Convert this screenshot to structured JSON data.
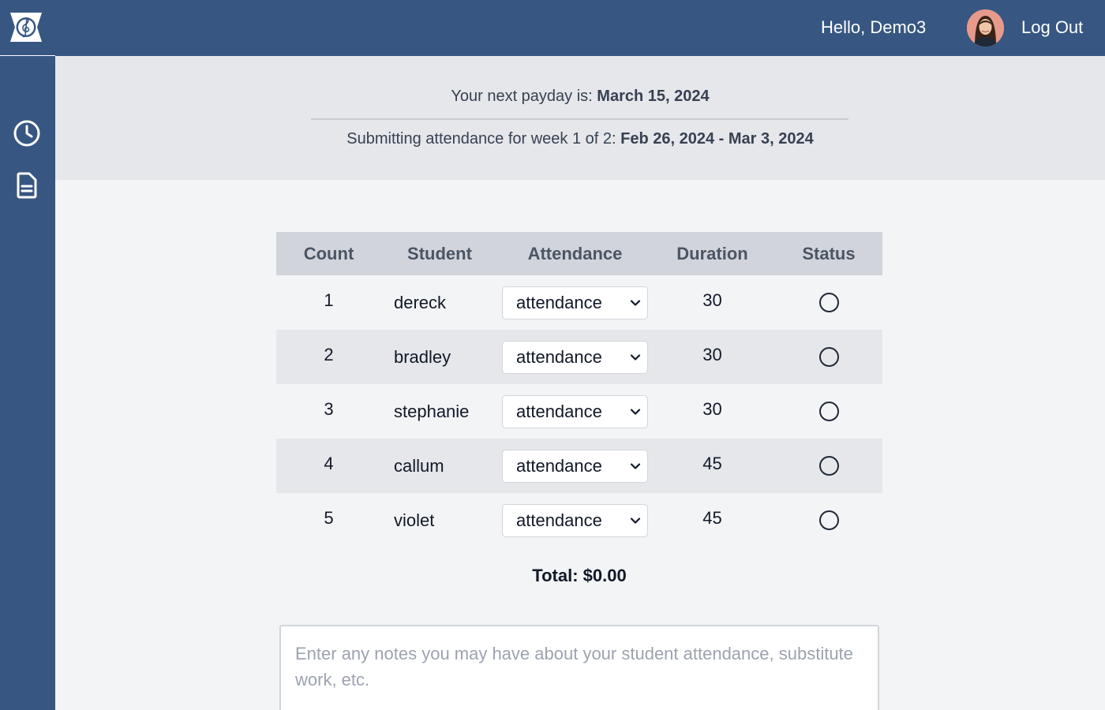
{
  "header": {
    "greeting": "Hello, Demo3",
    "logout_label": "Log Out"
  },
  "sidebar": {
    "items": [
      {
        "icon": "clock-icon"
      },
      {
        "icon": "document-icon"
      }
    ]
  },
  "info": {
    "payday_label": "Your next payday is:",
    "payday_date": "March 15, 2024",
    "week_label": "Submitting attendance for week 1 of 2:",
    "week_range": "Feb 26, 2024 - Mar 3, 2024"
  },
  "table": {
    "headers": {
      "count": "Count",
      "student": "Student",
      "attendance": "Attendance",
      "duration": "Duration",
      "status": "Status"
    },
    "rows": [
      {
        "count": "1",
        "student": "dereck",
        "attendance": "attendance",
        "duration": "30"
      },
      {
        "count": "2",
        "student": "bradley",
        "attendance": "attendance",
        "duration": "30"
      },
      {
        "count": "3",
        "student": "stephanie",
        "attendance": "attendance",
        "duration": "30"
      },
      {
        "count": "4",
        "student": "callum",
        "attendance": "attendance",
        "duration": "45"
      },
      {
        "count": "5",
        "student": "violet",
        "attendance": "attendance",
        "duration": "45"
      }
    ]
  },
  "total": "Total: $0.00",
  "notes": {
    "placeholder": "Enter any notes you may have about your student attendance, substitute work, etc.",
    "value": ""
  },
  "colors": {
    "brand": "#375782",
    "header_row": "#d1d5db",
    "alt_row": "#e5e7eb",
    "page_bg": "#f3f4f6"
  }
}
